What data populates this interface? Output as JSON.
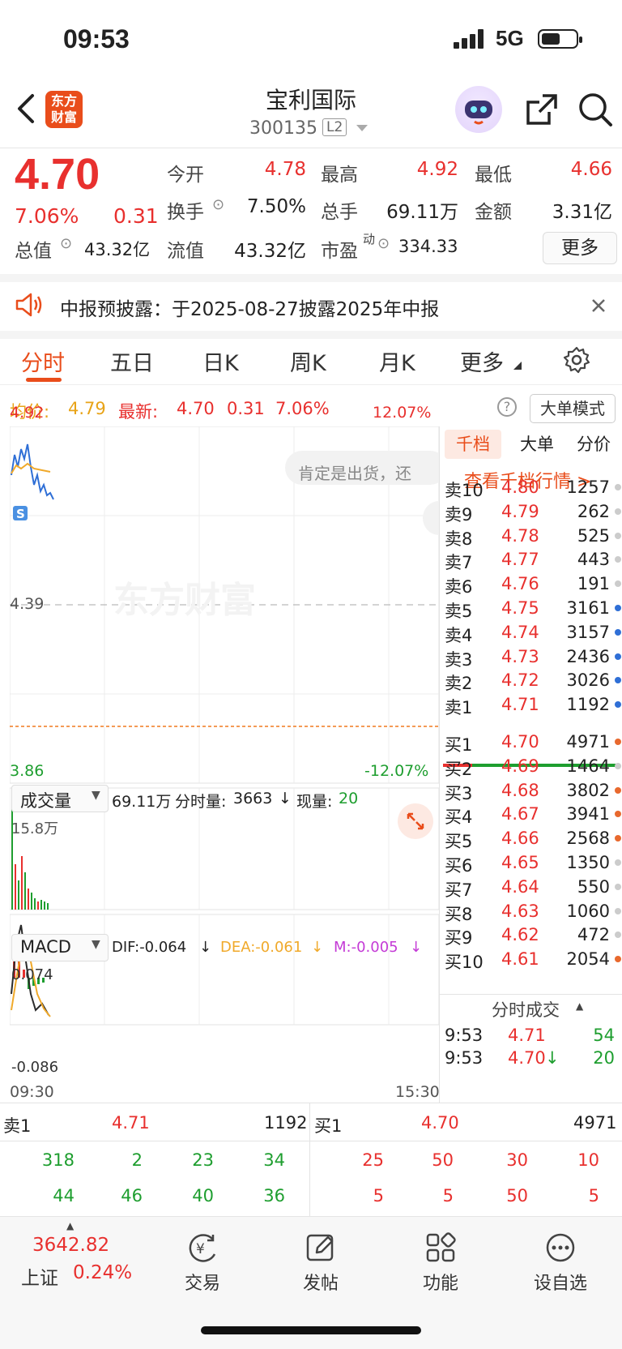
{
  "status": {
    "time": "09:53",
    "network": "5G"
  },
  "header": {
    "stock_name": "宝利国际",
    "stock_code": "300135",
    "level": "L2",
    "logo_text_1": "东方",
    "logo_text_2": "财富"
  },
  "quote": {
    "price": "4.70",
    "change_pct": "7.06%",
    "change": "0.31",
    "open_label": "今开",
    "open": "4.78",
    "high_label": "最高",
    "high": "4.92",
    "low_label": "最低",
    "low": "4.66",
    "turnover_label": "换手",
    "turnover": "7.50%",
    "volume_label": "总手",
    "volume": "69.11万",
    "amount_label": "金额",
    "amount": "3.31亿",
    "mktcap_label": "总值",
    "mktcap": "43.32亿",
    "float_label": "流值",
    "float": "43.32亿",
    "pe_label": "市盈",
    "pe_sup": "动",
    "pe": "334.33",
    "more": "更多"
  },
  "notice": {
    "text": "中报预披露：于2025-08-27披露2025年中报"
  },
  "tabs": [
    "分时",
    "五日",
    "日K",
    "周K",
    "月K",
    "更多"
  ],
  "infoline": {
    "avg_label": "均价:",
    "avg": "4.79",
    "latest_label": "最新:",
    "latest": "4.70",
    "change": "0.31",
    "pct": "7.06%",
    "mode": "大单模式"
  },
  "chart": {
    "top_price": "4.92",
    "top_pct": "12.07%",
    "mid_price": "4.39",
    "bottom_price": "3.86",
    "bottom_pct": "-12.07%",
    "watermark": "东方财富",
    "bubble": "肯定是出货，还",
    "vol_selector": "成交量",
    "vol_total": "69.11万",
    "vol_tick_label": "分时量:",
    "vol_tick": "3663",
    "vol_now_label": "现量:",
    "vol_now": "20",
    "vol_max": "15.8万",
    "macd_selector": "MACD",
    "dif": "DIF:-0.064",
    "dea": "DEA:-0.061",
    "m": "M:-0.005",
    "macd_top": "0.074",
    "macd_bottom": "-0.086",
    "time_start": "09:30",
    "time_end": "15:30"
  },
  "side": {
    "tabs": [
      "千档",
      "大单",
      "分价"
    ],
    "link": "查看千档行情 >",
    "asks": [
      {
        "label": "卖10",
        "price": "4.80",
        "vol": "1257",
        "dot": "#cccccc"
      },
      {
        "label": "卖9",
        "price": "4.79",
        "vol": "262",
        "dot": "#cccccc"
      },
      {
        "label": "卖8",
        "price": "4.78",
        "vol": "525",
        "dot": "#cccccc"
      },
      {
        "label": "卖7",
        "price": "4.77",
        "vol": "443",
        "dot": "#cccccc"
      },
      {
        "label": "卖6",
        "price": "4.76",
        "vol": "191",
        "dot": "#cccccc"
      },
      {
        "label": "卖5",
        "price": "4.75",
        "vol": "3161",
        "dot": "#2f6fd6"
      },
      {
        "label": "卖4",
        "price": "4.74",
        "vol": "3157",
        "dot": "#2f6fd6"
      },
      {
        "label": "卖3",
        "price": "4.73",
        "vol": "2436",
        "dot": "#2f6fd6"
      },
      {
        "label": "卖2",
        "price": "4.72",
        "vol": "3026",
        "dot": "#2f6fd6"
      },
      {
        "label": "卖1",
        "price": "4.71",
        "vol": "1192",
        "dot": "#2f6fd6"
      }
    ],
    "bids": [
      {
        "label": "买1",
        "price": "4.70",
        "vol": "4971",
        "dot": "#e8692e"
      },
      {
        "label": "买2",
        "price": "4.69",
        "vol": "1464",
        "dot": "#cccccc"
      },
      {
        "label": "买3",
        "price": "4.68",
        "vol": "3802",
        "dot": "#e8692e"
      },
      {
        "label": "买4",
        "price": "4.67",
        "vol": "3941",
        "dot": "#e8692e"
      },
      {
        "label": "买5",
        "price": "4.66",
        "vol": "2568",
        "dot": "#e8692e"
      },
      {
        "label": "买6",
        "price": "4.65",
        "vol": "1350",
        "dot": "#cccccc"
      },
      {
        "label": "买7",
        "price": "4.64",
        "vol": "550",
        "dot": "#cccccc"
      },
      {
        "label": "买8",
        "price": "4.63",
        "vol": "1060",
        "dot": "#cccccc"
      },
      {
        "label": "买9",
        "price": "4.62",
        "vol": "472",
        "dot": "#cccccc"
      },
      {
        "label": "买10",
        "price": "4.61",
        "vol": "2054",
        "dot": "#e8692e"
      }
    ],
    "ticks_title": "分时成交",
    "ticks": [
      {
        "time": "9:53",
        "price": "4.71",
        "vol": "54",
        "arrow": ""
      },
      {
        "time": "9:53",
        "price": "4.70",
        "vol": "20",
        "arrow": "↓"
      }
    ]
  },
  "bottom_ob": {
    "sell_label": "卖1",
    "sell_price": "4.71",
    "sell_vol": "1192",
    "buy_label": "买1",
    "buy_price": "4.70",
    "buy_vol": "4971",
    "sell_row1": [
      "318",
      "2",
      "23",
      "34"
    ],
    "sell_row2": [
      "44",
      "46",
      "40",
      "36"
    ],
    "buy_row1": [
      "25",
      "50",
      "30",
      "10"
    ],
    "buy_row2": [
      "5",
      "5",
      "50",
      "5"
    ]
  },
  "tabbar": {
    "index_value": "3642.82",
    "index_name": "上证",
    "index_pct": "0.24%",
    "items": [
      "交易",
      "发帖",
      "功能",
      "设自选"
    ]
  }
}
